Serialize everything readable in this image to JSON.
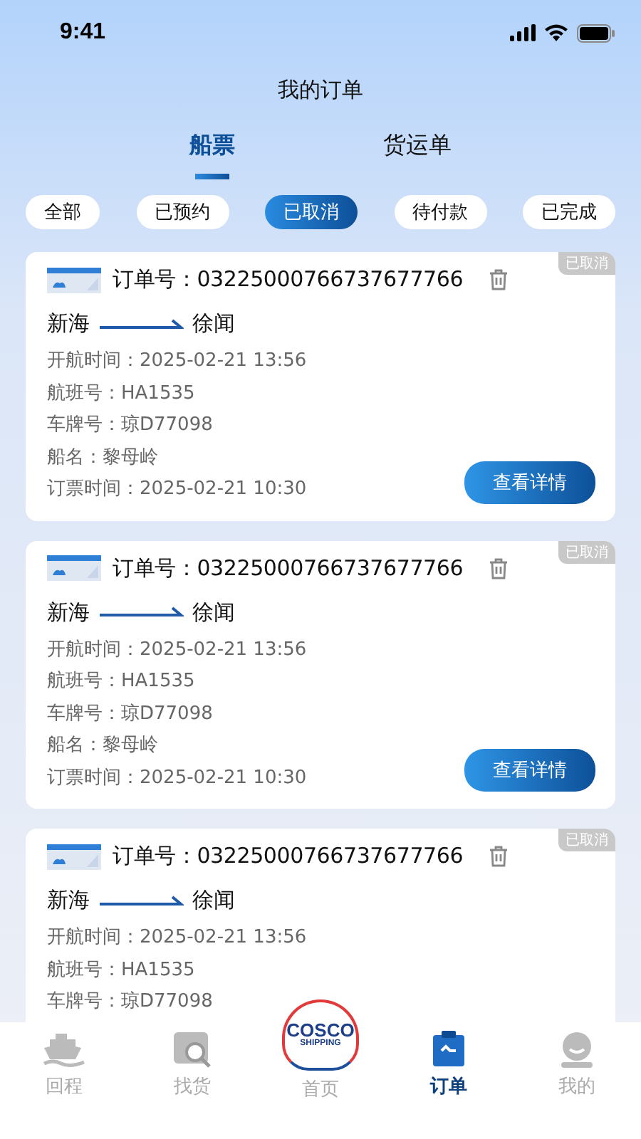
{
  "status_bar": {
    "time": "9:41"
  },
  "title": "我的订单",
  "tabs": [
    {
      "label": "船票",
      "selected": true
    },
    {
      "label": "货运单",
      "selected": false
    }
  ],
  "filters": [
    {
      "label": "全部",
      "selected": false
    },
    {
      "label": "已预约",
      "selected": false
    },
    {
      "label": "已取消",
      "selected": true
    },
    {
      "label": "待付款",
      "selected": false
    },
    {
      "label": "已完成",
      "selected": false
    }
  ],
  "orders": [
    {
      "status": "已取消",
      "order_no": "订单号：03225000766737677766",
      "from": "新海",
      "to": "徐闻",
      "fields": [
        "开航时间：2025-02-21 13:56",
        "航班号：HA1535",
        "车牌号：琼D77098",
        "船名：黎母岭",
        "订票时间：2025-02-21 10:30"
      ],
      "button": "查看详情"
    },
    {
      "status": "已取消",
      "order_no": "订单号：03225000766737677766",
      "from": "新海",
      "to": "徐闻",
      "fields": [
        "开航时间：2025-02-21 13:56",
        "航班号：HA1535",
        "车牌号：琼D77098",
        "船名：黎母岭",
        "订票时间：2025-02-21 10:30"
      ],
      "button": "查看详情"
    },
    {
      "status": "已取消",
      "order_no": "订单号：03225000766737677766",
      "from": "新海",
      "to": "徐闻",
      "fields": [
        "开航时间：2025-02-21 13:56",
        "航班号：HA1535",
        "车牌号：琼D77098"
      ]
    }
  ],
  "nav": [
    {
      "label": "回程",
      "selected": false
    },
    {
      "label": "找货",
      "selected": false
    },
    {
      "label": "首页",
      "selected": false,
      "logo": [
        "COSCO",
        "SHIPPING"
      ]
    },
    {
      "label": "订单",
      "selected": true
    },
    {
      "label": "我的",
      "selected": false
    }
  ]
}
